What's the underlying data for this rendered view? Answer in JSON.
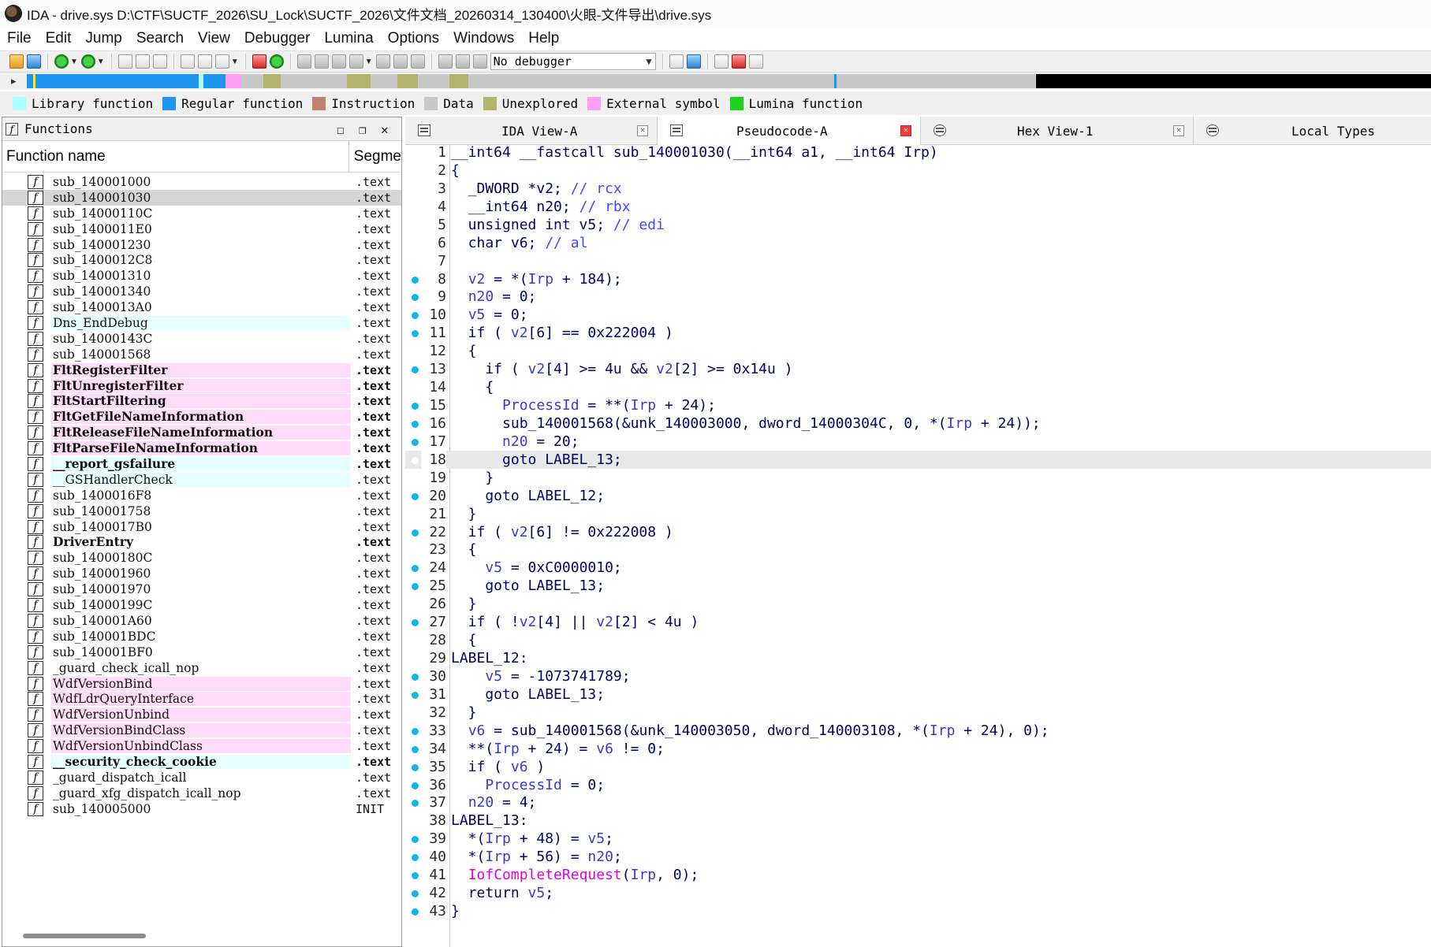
{
  "window": {
    "title": "IDA - drive.sys D:\\CTF\\SUCTF_2026\\SU_Lock\\SUCTF_2026\\文件文档_20260314_130400\\火眼-文件导出\\drive.sys"
  },
  "menu": [
    "File",
    "Edit",
    "Jump",
    "Search",
    "View",
    "Debugger",
    "Lumina",
    "Options",
    "Windows",
    "Help"
  ],
  "toolbar": {
    "debugger_select": "No debugger"
  },
  "legend": [
    {
      "label": "Library function",
      "color": "#aaffff"
    },
    {
      "label": "Regular function",
      "color": "#1e96f0"
    },
    {
      "label": "Instruction",
      "color": "#c0826a"
    },
    {
      "label": "Data",
      "color": "#c8c8c8"
    },
    {
      "label": "Unexplored",
      "color": "#b4b46e"
    },
    {
      "label": "External symbol",
      "color": "#ff9ef5"
    },
    {
      "label": "Lumina function",
      "color": "#1ed21e"
    }
  ],
  "functions_panel": {
    "title": "Functions",
    "col_name": "Function name",
    "col_segment": "Segme",
    "items": [
      {
        "name": "sub_140001000",
        "seg": ".text",
        "type": "reg"
      },
      {
        "name": "sub_140001030",
        "seg": ".text",
        "type": "reg",
        "selected": true
      },
      {
        "name": "sub_14000110C",
        "seg": ".text",
        "type": "reg"
      },
      {
        "name": "sub_1400011E0",
        "seg": ".text",
        "type": "reg"
      },
      {
        "name": "sub_140001230",
        "seg": ".text",
        "type": "reg"
      },
      {
        "name": "sub_1400012C8",
        "seg": ".text",
        "type": "reg"
      },
      {
        "name": "sub_140001310",
        "seg": ".text",
        "type": "reg"
      },
      {
        "name": "sub_140001340",
        "seg": ".text",
        "type": "reg"
      },
      {
        "name": "sub_1400013A0",
        "seg": ".text",
        "type": "reg"
      },
      {
        "name": "Dns_EndDebug",
        "seg": ".text",
        "type": "lib"
      },
      {
        "name": "sub_14000143C",
        "seg": ".text",
        "type": "reg"
      },
      {
        "name": "sub_140001568",
        "seg": ".text",
        "type": "reg"
      },
      {
        "name": "FltRegisterFilter",
        "seg": ".text",
        "type": "ext",
        "bold": true
      },
      {
        "name": "FltUnregisterFilter",
        "seg": ".text",
        "type": "ext",
        "bold": true
      },
      {
        "name": "FltStartFiltering",
        "seg": ".text",
        "type": "ext",
        "bold": true
      },
      {
        "name": "FltGetFileNameInformation",
        "seg": ".text",
        "type": "ext",
        "bold": true
      },
      {
        "name": "FltReleaseFileNameInformation",
        "seg": ".text",
        "type": "ext",
        "bold": true
      },
      {
        "name": "FltParseFileNameInformation",
        "seg": ".text",
        "type": "ext",
        "bold": true
      },
      {
        "name": "__report_gsfailure",
        "seg": ".text",
        "type": "lib",
        "bold": true
      },
      {
        "name": "__GSHandlerCheck",
        "seg": ".text",
        "type": "lib"
      },
      {
        "name": "sub_1400016F8",
        "seg": ".text",
        "type": "reg"
      },
      {
        "name": "sub_140001758",
        "seg": ".text",
        "type": "reg"
      },
      {
        "name": "sub_1400017B0",
        "seg": ".text",
        "type": "reg"
      },
      {
        "name": "DriverEntry",
        "seg": ".text",
        "type": "reg",
        "bold": true
      },
      {
        "name": "sub_14000180C",
        "seg": ".text",
        "type": "reg"
      },
      {
        "name": "sub_140001960",
        "seg": ".text",
        "type": "reg"
      },
      {
        "name": "sub_140001970",
        "seg": ".text",
        "type": "reg"
      },
      {
        "name": "sub_14000199C",
        "seg": ".text",
        "type": "reg"
      },
      {
        "name": "sub_140001A60",
        "seg": ".text",
        "type": "reg"
      },
      {
        "name": "sub_140001BDC",
        "seg": ".text",
        "type": "reg"
      },
      {
        "name": "sub_140001BF0",
        "seg": ".text",
        "type": "reg"
      },
      {
        "name": "_guard_check_icall_nop",
        "seg": ".text",
        "type": "reg"
      },
      {
        "name": "WdfVersionBind",
        "seg": ".text",
        "type": "ext"
      },
      {
        "name": "WdfLdrQueryInterface",
        "seg": ".text",
        "type": "ext"
      },
      {
        "name": "WdfVersionUnbind",
        "seg": ".text",
        "type": "ext"
      },
      {
        "name": "WdfVersionBindClass",
        "seg": ".text",
        "type": "ext"
      },
      {
        "name": "WdfVersionUnbindClass",
        "seg": ".text",
        "type": "ext"
      },
      {
        "name": "__security_check_cookie",
        "seg": ".text",
        "type": "lib",
        "bold": true
      },
      {
        "name": "_guard_dispatch_icall",
        "seg": ".text",
        "type": "reg"
      },
      {
        "name": "_guard_xfg_dispatch_icall_nop",
        "seg": ".text",
        "type": "reg"
      },
      {
        "name": "sub_140005000",
        "seg": "INIT",
        "type": "reg"
      }
    ]
  },
  "tabs": [
    {
      "label": "IDA View-A"
    },
    {
      "label": "Pseudocode-A",
      "active": true
    },
    {
      "label": "Hex View-1"
    },
    {
      "label": "Local Types"
    }
  ],
  "code": [
    {
      "n": "1",
      "dot": false,
      "html": "__int64 __fastcall sub_140001030(__int64 a1, __int64 Irp)"
    },
    {
      "n": "2",
      "dot": false,
      "html": "{"
    },
    {
      "n": "3",
      "dot": false,
      "html": "  _DWORD *v2; <span class='cmt'>// rcx</span>"
    },
    {
      "n": "4",
      "dot": false,
      "html": "  __int64 n20; <span class='cmt'>// rbx</span>"
    },
    {
      "n": "5",
      "dot": false,
      "html": "  unsigned int v5; <span class='cmt'>// edi</span>"
    },
    {
      "n": "6",
      "dot": false,
      "html": "  char v6; <span class='cmt'>// al</span>"
    },
    {
      "n": "7",
      "dot": false,
      "html": ""
    },
    {
      "n": "8",
      "dot": true,
      "html": "  <span class='var'>v2</span> = *(<span class='var'>Irp</span> + 184);"
    },
    {
      "n": "9",
      "dot": true,
      "html": "  <span class='var'>n20</span> = 0;"
    },
    {
      "n": "10",
      "dot": true,
      "html": "  <span class='var'>v5</span> = 0;"
    },
    {
      "n": "11",
      "dot": true,
      "html": "  if ( <span class='var'>v2</span>[6] == 0x222004 )"
    },
    {
      "n": "12",
      "dot": false,
      "html": "  {"
    },
    {
      "n": "13",
      "dot": true,
      "html": "    if ( <span class='var'>v2</span>[4] >= 4u && <span class='var'>v2</span>[2] >= 0x14u )"
    },
    {
      "n": "14",
      "dot": false,
      "html": "    {"
    },
    {
      "n": "15",
      "dot": true,
      "html": "      <span class='var'>ProcessId</span> = **(<span class='var'>Irp</span> + 24);"
    },
    {
      "n": "16",
      "dot": true,
      "html": "      sub_140001568(&unk_140003000, dword_14000304C, 0, *(<span class='var'>Irp</span> + 24));"
    },
    {
      "n": "17",
      "dot": true,
      "html": "      <span class='var'>n20</span> = 20;"
    },
    {
      "n": "18",
      "dot": true,
      "html": "      goto LABEL_13;",
      "hl": true
    },
    {
      "n": "19",
      "dot": false,
      "html": "    }"
    },
    {
      "n": "20",
      "dot": true,
      "html": "    goto LABEL_12;"
    },
    {
      "n": "21",
      "dot": false,
      "html": "  }"
    },
    {
      "n": "22",
      "dot": true,
      "html": "  if ( <span class='var'>v2</span>[6] != 0x222008 )"
    },
    {
      "n": "23",
      "dot": false,
      "html": "  {"
    },
    {
      "n": "24",
      "dot": true,
      "html": "    <span class='var'>v5</span> = 0xC0000010;"
    },
    {
      "n": "25",
      "dot": true,
      "html": "    goto LABEL_13;"
    },
    {
      "n": "26",
      "dot": false,
      "html": "  }"
    },
    {
      "n": "27",
      "dot": true,
      "html": "  if ( !<span class='var'>v2</span>[4] || <span class='var'>v2</span>[2] < 4u )"
    },
    {
      "n": "28",
      "dot": false,
      "html": "  {"
    },
    {
      "n": "29",
      "dot": false,
      "html": "LABEL_12:"
    },
    {
      "n": "30",
      "dot": true,
      "html": "    <span class='var'>v5</span> = -1073741789;"
    },
    {
      "n": "31",
      "dot": true,
      "html": "    goto LABEL_13;"
    },
    {
      "n": "32",
      "dot": false,
      "html": "  }"
    },
    {
      "n": "33",
      "dot": true,
      "html": "  <span class='var'>v6</span> = sub_140001568(&unk_140003050, dword_140003108, *(<span class='var'>Irp</span> + 24), 0);"
    },
    {
      "n": "34",
      "dot": true,
      "html": "  **(<span class='var'>Irp</span> + 24) = <span class='var'>v6</span> != 0;"
    },
    {
      "n": "35",
      "dot": true,
      "html": "  if ( <span class='var'>v6</span> )"
    },
    {
      "n": "36",
      "dot": true,
      "html": "    <span class='var'>ProcessId</span> = 0;"
    },
    {
      "n": "37",
      "dot": true,
      "html": "  <span class='var'>n20</span> = 4;"
    },
    {
      "n": "38",
      "dot": false,
      "html": "LABEL_13:"
    },
    {
      "n": "39",
      "dot": true,
      "html": "  *(<span class='var'>Irp</span> + 48) = <span class='var'>v5</span>;"
    },
    {
      "n": "40",
      "dot": true,
      "html": "  *(<span class='var'>Irp</span> + 56) = <span class='var'>n20</span>;"
    },
    {
      "n": "41",
      "dot": true,
      "html": "  <span class='pink'>IofCompleteRequest</span>(<span class='var'>Irp</span>, 0);"
    },
    {
      "n": "42",
      "dot": true,
      "html": "  return <span class='var'>v5</span>;"
    },
    {
      "n": "43",
      "dot": true,
      "html": "}"
    }
  ]
}
